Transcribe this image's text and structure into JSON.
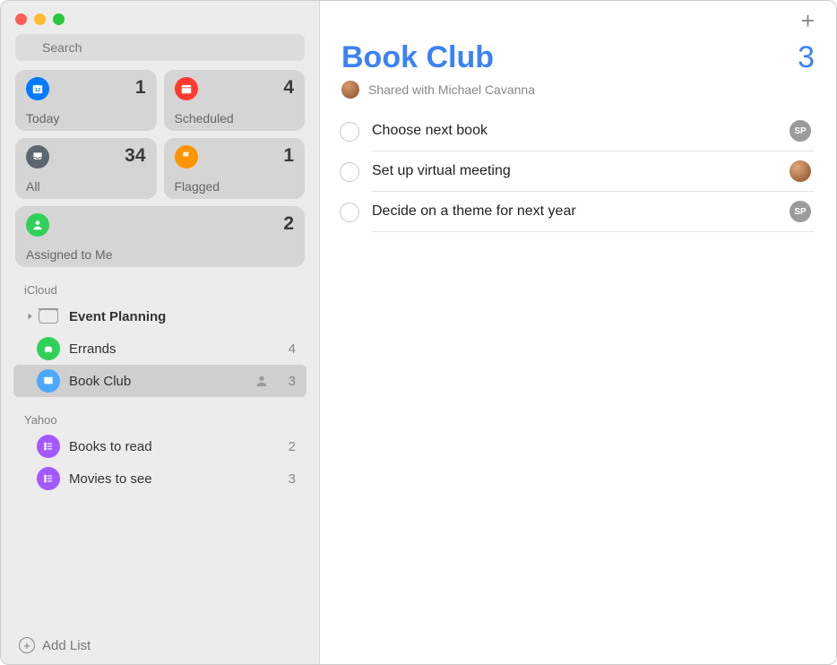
{
  "search": {
    "placeholder": "Search"
  },
  "smart": {
    "today": {
      "label": "Today",
      "count": "1",
      "color": "#007aff"
    },
    "scheduled": {
      "label": "Scheduled",
      "count": "4",
      "color": "#ff3b30"
    },
    "all": {
      "label": "All",
      "count": "34",
      "color": "#5b6670"
    },
    "flagged": {
      "label": "Flagged",
      "count": "1",
      "color": "#ff9500"
    },
    "assigned": {
      "label": "Assigned to Me",
      "count": "2",
      "color": "#30d158"
    }
  },
  "sections": {
    "icloud": {
      "header": "iCloud"
    },
    "yahoo": {
      "header": "Yahoo"
    }
  },
  "lists": {
    "event_planning": {
      "name": "Event Planning"
    },
    "errands": {
      "name": "Errands",
      "count": "4",
      "color": "#30d158"
    },
    "book_club": {
      "name": "Book Club",
      "count": "3",
      "color": "#4aa8ff"
    },
    "books_to_read": {
      "name": "Books to read",
      "count": "2",
      "color": "#a259ff"
    },
    "movies_to_see": {
      "name": "Movies to see",
      "count": "3",
      "color": "#a259ff"
    }
  },
  "footer": {
    "add_list": "Add List"
  },
  "main": {
    "title": "Book Club",
    "count": "3",
    "shared_label": "Shared with Michael Cavanna",
    "reminders": [
      {
        "title": "Choose next book",
        "assignee_type": "initials",
        "assignee": "SP"
      },
      {
        "title": "Set up virtual meeting",
        "assignee_type": "avatar",
        "assignee": ""
      },
      {
        "title": "Decide on a theme for next year",
        "assignee_type": "initials",
        "assignee": "SP"
      }
    ]
  }
}
